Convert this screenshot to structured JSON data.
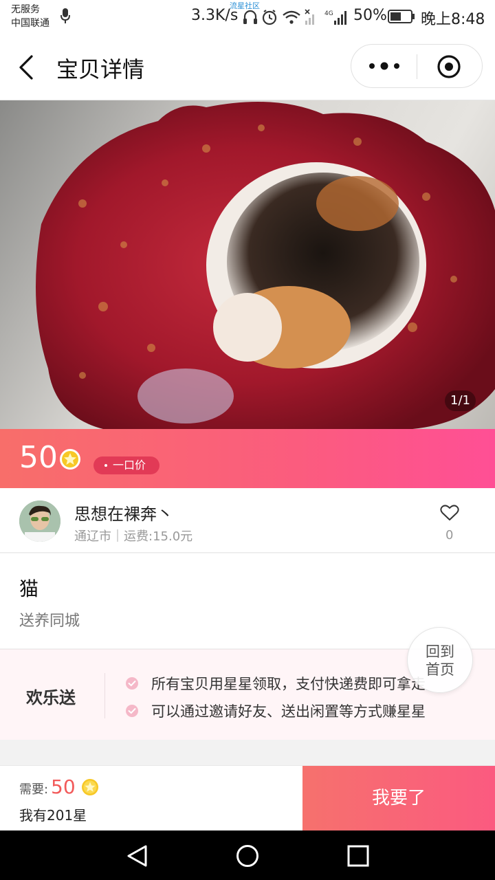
{
  "status_bar": {
    "carrier_line1": "无服务",
    "carrier_line2": "中国联通",
    "watermark": "流星社区",
    "speed": "3.3K/s",
    "network": "4G",
    "battery": "50%",
    "time": "晚上8:48"
  },
  "nav": {
    "title": "宝贝详情"
  },
  "gallery": {
    "indicator": "1/1"
  },
  "price": {
    "value": "50",
    "tag": "一口价"
  },
  "seller": {
    "name": "思想在裸奔丶",
    "meta": "通辽市｜运费:15.0元",
    "likes": "0"
  },
  "item": {
    "title": "猫",
    "description": "送养同城"
  },
  "promo": {
    "label": "欢乐送",
    "line1": "所有宝贝用星星领取，支付快递费即可拿走",
    "line2": "可以通过邀请好友、送出闲置等方式赚星星"
  },
  "home_button": {
    "line1": "回到",
    "line2": "首页"
  },
  "bottom": {
    "need_label": "需要:",
    "need_value": "50",
    "have": "我有201星",
    "action": "我要了"
  },
  "colors": {
    "accent_start": "#f86e6a",
    "accent_end": "#ff4f95",
    "star": "#f7c826"
  }
}
